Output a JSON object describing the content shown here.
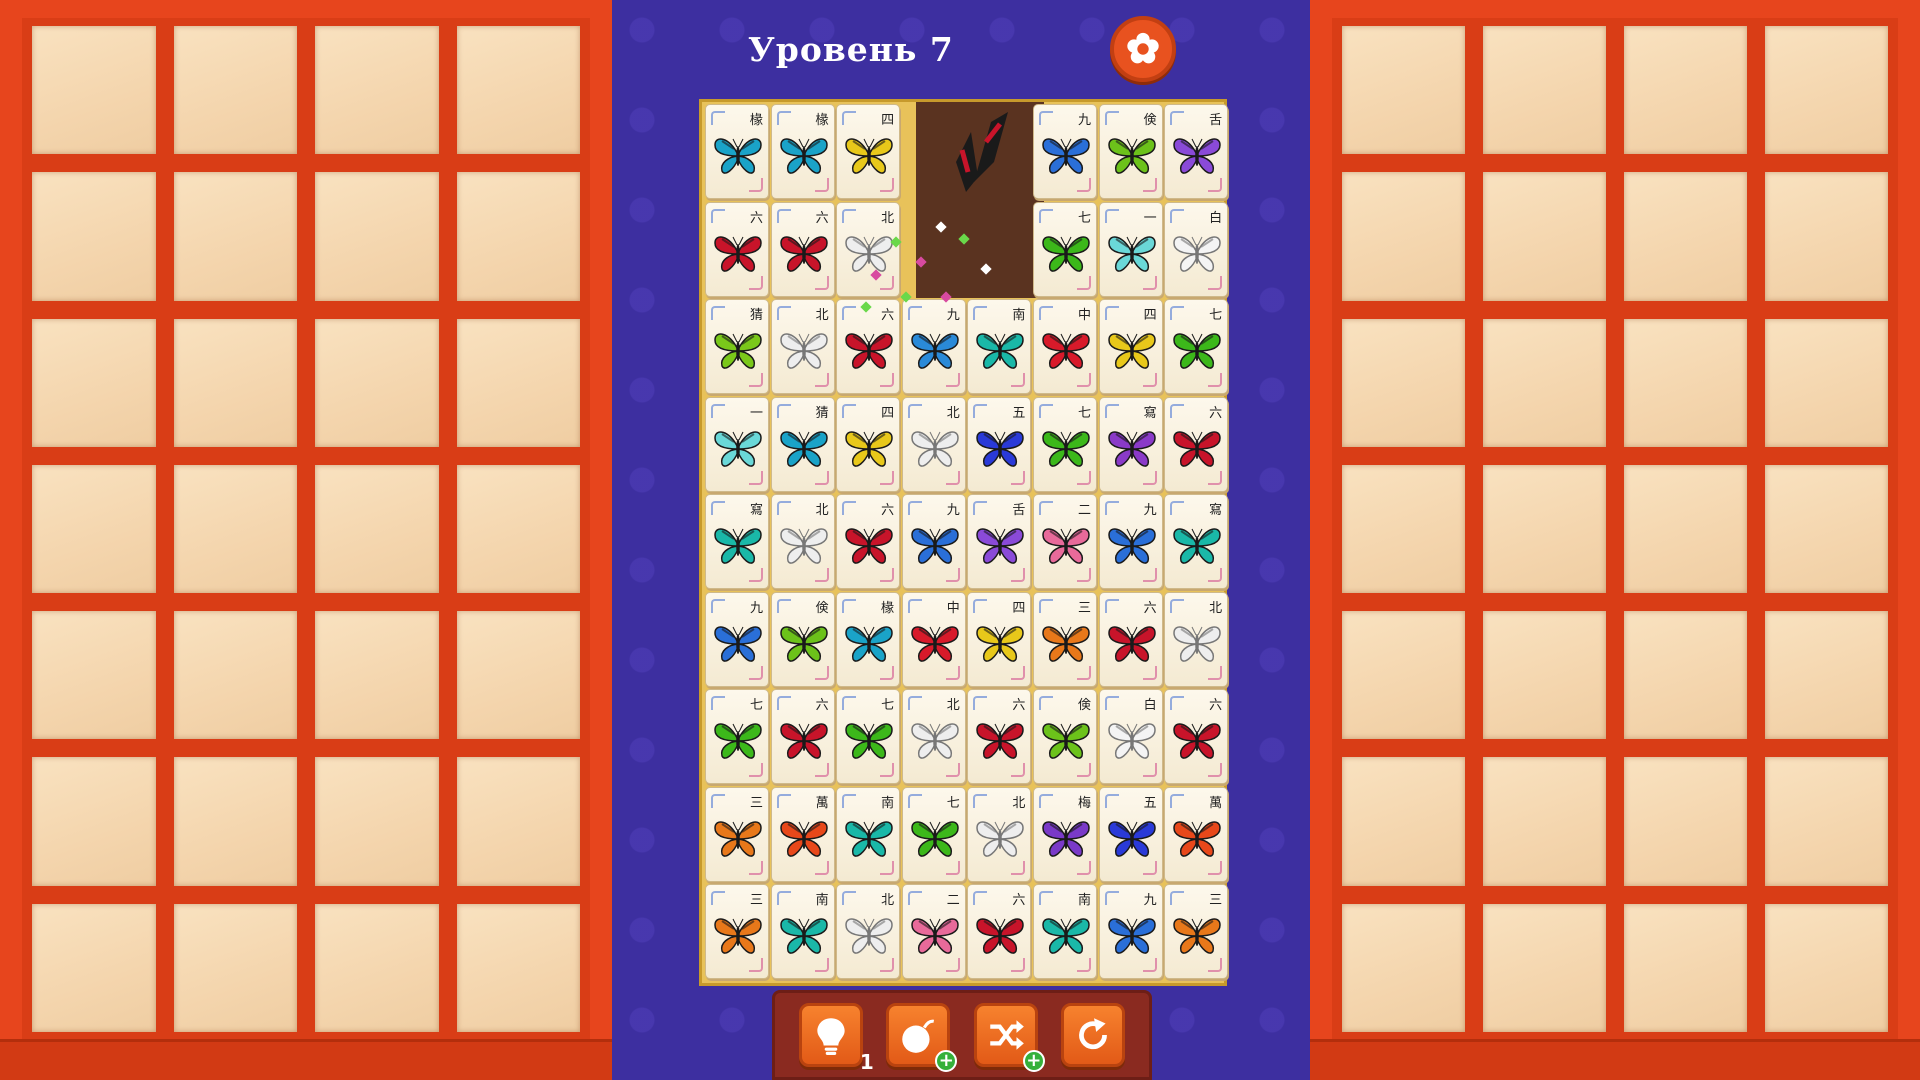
{
  "header": {
    "level_title": "Уровень 7"
  },
  "board": {
    "columns": 8,
    "rows": 9,
    "tiles": [
      [
        {
          "glyph": "椽",
          "color": "#1aa3c8"
        },
        {
          "glyph": "椽",
          "color": "#1aa3c8"
        },
        {
          "glyph": "四",
          "color": "#e8c81a"
        },
        null,
        null,
        {
          "glyph": "九",
          "color": "#2a6fd8"
        },
        {
          "glyph": "倹",
          "color": "#6cc21a"
        },
        {
          "glyph": "舌",
          "color": "#8a4ad8"
        }
      ],
      [
        {
          "glyph": "六",
          "color": "#c8142a"
        },
        {
          "glyph": "六",
          "color": "#c8142a"
        },
        {
          "glyph": "北",
          "color": "#eeeeee"
        },
        null,
        null,
        {
          "glyph": "七",
          "color": "#3cb81a"
        },
        {
          "glyph": "一",
          "color": "#6ad8d8"
        },
        {
          "glyph": "白",
          "color": "#f4f4f4"
        }
      ],
      [
        {
          "glyph": "猜",
          "color": "#7ac81a"
        },
        {
          "glyph": "北",
          "color": "#eeeeee"
        },
        {
          "glyph": "六",
          "color": "#c8142a"
        },
        {
          "glyph": "九",
          "color": "#2a8ad8"
        },
        {
          "glyph": "南",
          "color": "#1ab8a8"
        },
        {
          "glyph": "中",
          "color": "#d81a2a"
        },
        {
          "glyph": "四",
          "color": "#e8c81a"
        },
        {
          "glyph": "七",
          "color": "#3cb81a"
        }
      ],
      [
        {
          "glyph": "一",
          "color": "#6ad8d8"
        },
        {
          "glyph": "猜",
          "color": "#1aa3c8"
        },
        {
          "glyph": "四",
          "color": "#e8c81a"
        },
        {
          "glyph": "北",
          "color": "#eeeeee"
        },
        {
          "glyph": "五",
          "color": "#2a3ad8"
        },
        {
          "glyph": "七",
          "color": "#3cb81a"
        },
        {
          "glyph": "寫",
          "color": "#8a3ac8"
        },
        {
          "glyph": "六",
          "color": "#c8142a"
        }
      ],
      [
        {
          "glyph": "寫",
          "color": "#1ab8a8"
        },
        {
          "glyph": "北",
          "color": "#eeeeee"
        },
        {
          "glyph": "六",
          "color": "#c8142a"
        },
        {
          "glyph": "九",
          "color": "#2a6fd8"
        },
        {
          "glyph": "舌",
          "color": "#8a4ad8"
        },
        {
          "glyph": "二",
          "color": "#e86a9a"
        },
        {
          "glyph": "九",
          "color": "#2a6fd8"
        },
        {
          "glyph": "寫",
          "color": "#1ab8a8"
        }
      ],
      [
        {
          "glyph": "九",
          "color": "#2a6fd8"
        },
        {
          "glyph": "倹",
          "color": "#6cc21a"
        },
        {
          "glyph": "椽",
          "color": "#1aa3c8"
        },
        {
          "glyph": "中",
          "color": "#d81a2a"
        },
        {
          "glyph": "四",
          "color": "#e8c81a"
        },
        {
          "glyph": "三",
          "color": "#e8781a"
        },
        {
          "glyph": "六",
          "color": "#c8142a"
        },
        {
          "glyph": "北",
          "color": "#eeeeee"
        }
      ],
      [
        {
          "glyph": "七",
          "color": "#3cb81a"
        },
        {
          "glyph": "六",
          "color": "#c8142a"
        },
        {
          "glyph": "七",
          "color": "#3cb81a"
        },
        {
          "glyph": "北",
          "color": "#eeeeee"
        },
        {
          "glyph": "六",
          "color": "#c8142a"
        },
        {
          "glyph": "倹",
          "color": "#6cc21a"
        },
        {
          "glyph": "白",
          "color": "#f4f4f4"
        },
        {
          "glyph": "六",
          "color": "#c8142a"
        }
      ],
      [
        {
          "glyph": "三",
          "color": "#e8781a"
        },
        {
          "glyph": "萬",
          "color": "#e8481a"
        },
        {
          "glyph": "南",
          "color": "#1ab8a8"
        },
        {
          "glyph": "七",
          "color": "#3cb81a"
        },
        {
          "glyph": "北",
          "color": "#eeeeee"
        },
        {
          "glyph": "梅",
          "color": "#7a3ac8"
        },
        {
          "glyph": "五",
          "color": "#2a3ad8"
        },
        {
          "glyph": "萬",
          "color": "#e8481a"
        }
      ],
      [
        {
          "glyph": "三",
          "color": "#e8781a"
        },
        {
          "glyph": "南",
          "color": "#1ab8a8"
        },
        {
          "glyph": "北",
          "color": "#eeeeee"
        },
        {
          "glyph": "二",
          "color": "#e86a9a"
        },
        {
          "glyph": "六",
          "color": "#c8142a"
        },
        {
          "glyph": "南",
          "color": "#1ab8a8"
        },
        {
          "glyph": "九",
          "color": "#2a6fd8"
        },
        {
          "glyph": "三",
          "color": "#e8781a"
        }
      ]
    ]
  },
  "toolbar": {
    "hint_icon": "lightbulb-icon",
    "hint_count": "1",
    "bomb_icon": "bomb-icon",
    "shuffle_icon": "shuffle-icon",
    "restart_icon": "restart-icon",
    "plus_label": "+"
  },
  "colors": {
    "frame": "#e7451d",
    "background": "#3d2fa0",
    "button": "#e8521f"
  }
}
